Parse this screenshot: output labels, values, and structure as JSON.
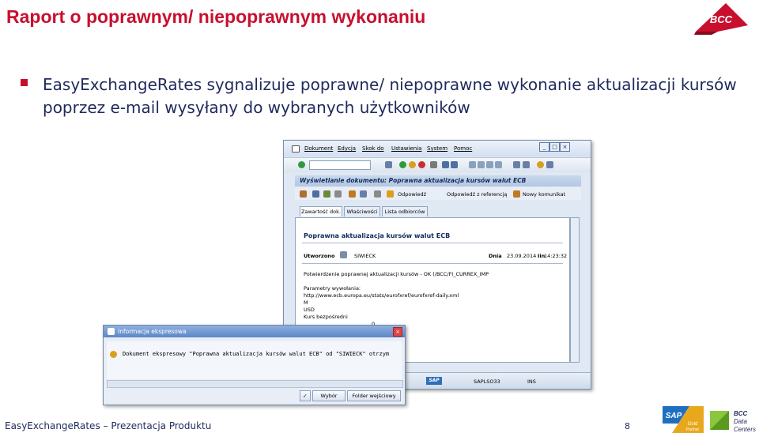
{
  "slide": {
    "title": "Raport o poprawnym/ niepoprawnym wykonaniu",
    "bullet": "EasyExchangeRates sygnalizuje poprawne/ niepoprawne wykonanie aktualizacji kursów poprzez e-mail wysyłany do wybranych użytkowników",
    "footer": "EasyExchangeRates – Prezentacja Produktu",
    "page_number": "8",
    "logo_text": "BCC",
    "sap_partner": {
      "sap": "SAP",
      "gold": "Gold",
      "partner": "Partner"
    },
    "bcc_dc": {
      "line1": "BCC",
      "line2": "Data",
      "line3": "Centers"
    },
    "accent_color": "#c8102e"
  },
  "sap_window": {
    "menu": [
      "Dokument",
      "Edycja",
      "Skok do",
      "Ustawienia",
      "System",
      "Pomoc"
    ],
    "doc_title": "Wyświetlanie dokumentu: Poprawna aktualizacja kursów walut ECB",
    "toolbar2": {
      "reply": "Odpowiedź",
      "reply_ref": "Odpowiedź z referencją",
      "new_message": "Nowy komunikat"
    },
    "tabs": [
      "Zawartość dok.",
      "Właściwości",
      "Lista odbiorców"
    ],
    "content": {
      "subject": "Poprawna aktualizacja kursów walut ECB",
      "created_label": "Utworzono",
      "created_by": "SIWIECK",
      "date_label": "Dnia",
      "date_value": "23.09.2014",
      "time_label": "Iin",
      "time_value": "14:23:32",
      "confirm": "Potwierdzenie poprawnej aktualizacji kursów - OK (/BCC/FI_CURREX_IMP",
      "params_label": "Parametry wywołania:",
      "url": "http://www.ecb.europa.eu/stats/eurofxref/eurofxref-daily.xml",
      "m": "M",
      "usd": "USD",
      "rate_type": "Kurs bezpośredni",
      "zero": "0"
    },
    "status": {
      "sap": "SAP",
      "program": "SAPLSO33",
      "mode": "INS"
    }
  },
  "popup": {
    "title": "Informacja ekspresowa",
    "message": "Dokument ekspresowy \"Poprawna aktualizacja kursów walut ECB\" od \"SIWIECK\" otrzym",
    "choose": "Wybór",
    "inbox": "Folder wejściowy"
  }
}
